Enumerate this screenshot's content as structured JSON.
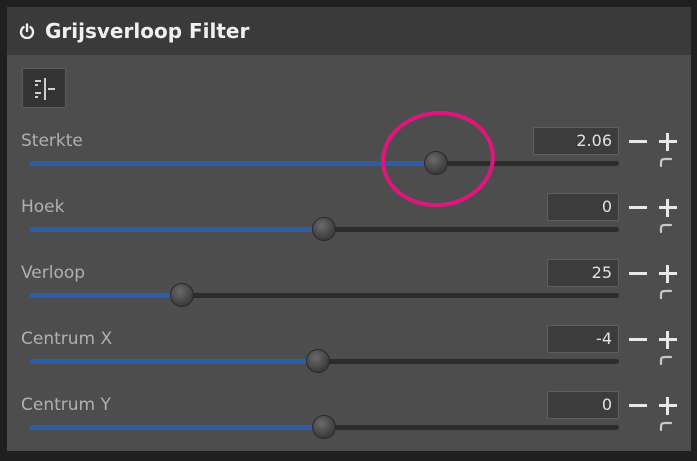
{
  "header": {
    "title": "Grijsverloop Filter",
    "power_icon": "power-icon"
  },
  "toolbar": {
    "mode_icon": "split-view-icon"
  },
  "params": [
    {
      "label": "Sterkte",
      "value": "2.06",
      "level": 0.69
    },
    {
      "label": "Hoek",
      "value": "0",
      "level": 0.5
    },
    {
      "label": "Verloop",
      "value": "25",
      "level": 0.26
    },
    {
      "label": "Centrum X",
      "value": "-4",
      "level": 0.49
    },
    {
      "label": "Centrum Y",
      "value": "0",
      "level": 0.5
    }
  ],
  "colors": {
    "accent": "#2d5ca8",
    "highlight": "#e0157d",
    "panel": "#4d4d4d",
    "header": "#3a3a3a"
  }
}
